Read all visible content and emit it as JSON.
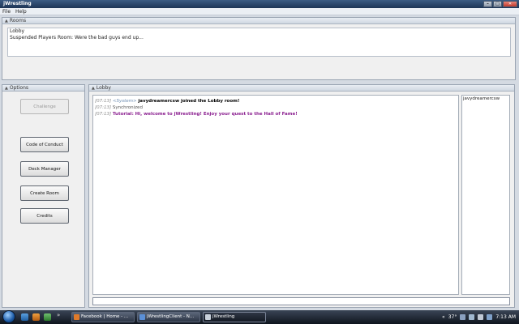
{
  "window": {
    "title": "jWrestling"
  },
  "window_controls": {
    "minimize": "–",
    "maximize": "□",
    "close": "✕"
  },
  "menu": {
    "items": [
      "File",
      "Help"
    ]
  },
  "rooms": {
    "title": "Rooms",
    "items": [
      "Lobby",
      "Suspended Players Room: Were the bad guys end up..."
    ]
  },
  "options": {
    "title": "Options",
    "buttons": [
      "Challenge",
      "Code of Conduct",
      "Deck Manager",
      "Create Room",
      "Credits"
    ]
  },
  "lobby": {
    "title": "Lobby",
    "messages": [
      {
        "time": "[07:13]",
        "sender": "<System>",
        "text": "javydreamercsw joined the Lobby room!"
      },
      {
        "time": "[07:13]",
        "sender": "",
        "text": "Synchronized"
      },
      {
        "time": "[07:13]",
        "sender": "",
        "text": "Tutorial: Hi, welcome to jWrestling! Enjoy your quest to the Hall of Fame!"
      }
    ],
    "users": [
      "javydreamercsw"
    ],
    "input_value": ""
  },
  "taskbar": {
    "quick_launch_more": "»",
    "tasks": [
      {
        "label": "Facebook | Home - ...",
        "active": false,
        "icon_color": "#e07a2a"
      },
      {
        "label": "jWrestlingClient - N...",
        "active": false,
        "icon_color": "#5b8fd6"
      },
      {
        "label": "jWrestling",
        "active": true,
        "icon_color": "#c8d0da"
      }
    ],
    "tray": {
      "arrow": "«",
      "temperature": "37°",
      "time": "7:13 AM"
    }
  }
}
